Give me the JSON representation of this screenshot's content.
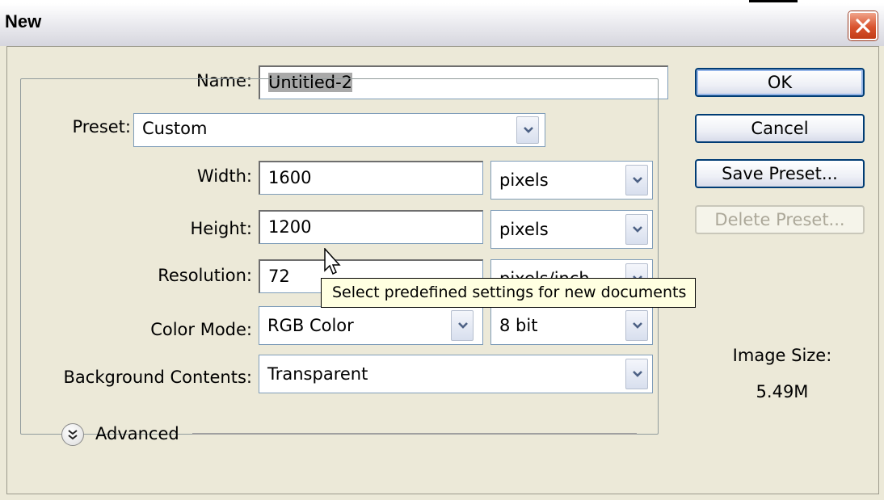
{
  "window": {
    "title": "New"
  },
  "fields": {
    "name": {
      "label": "Name:",
      "value": "Untitled-2"
    },
    "preset": {
      "label": "Preset:",
      "value": "Custom"
    },
    "width": {
      "label": "Width:",
      "value": "1600",
      "unit": "pixels"
    },
    "height": {
      "label": "Height:",
      "value": "1200",
      "unit": "pixels"
    },
    "resolution": {
      "label": "Resolution:",
      "value": "72",
      "unit": "pixels/inch"
    },
    "color_mode": {
      "label": "Color Mode:",
      "value": "RGB Color",
      "depth": "8 bit"
    },
    "background": {
      "label": "Background Contents:",
      "value": "Transparent"
    }
  },
  "advanced": {
    "label": "Advanced"
  },
  "buttons": {
    "ok": "OK",
    "cancel": "Cancel",
    "save_preset": "Save Preset...",
    "delete_preset": "Delete Preset..."
  },
  "image_size": {
    "label": "Image Size:",
    "value": "5.49M"
  },
  "tooltip": "Select predefined settings for new documents",
  "icons": {
    "close": "close-icon",
    "dropdown": "chevron-down-icon",
    "advanced_toggle": "double-chevron-down-icon",
    "cursor": "mouse-pointer-icon"
  },
  "colors": {
    "dialog_bg": "#ece9d8",
    "button_border": "#003c74",
    "tooltip_bg": "#ffffe1",
    "close_red": "#d9532e"
  }
}
